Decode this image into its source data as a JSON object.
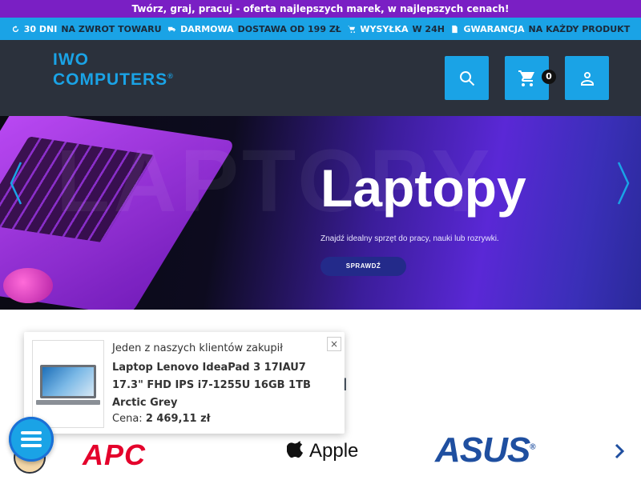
{
  "topbar": {
    "text": "Twórz, graj, pracuj - oferta najlepszych marek, w najlepszych cenach!"
  },
  "benefits": [
    {
      "icon": "return-icon",
      "highlight": "30 DNI",
      "text": "NA ZWROT TOWARU"
    },
    {
      "icon": "truck-icon",
      "highlight": "DARMOWA",
      "text": "DOSTAWA OD 199 ZŁ"
    },
    {
      "icon": "cart-icon",
      "highlight": "WYSYŁKA",
      "text": "W 24H"
    },
    {
      "icon": "document-icon",
      "highlight": "GWARANCJA",
      "text": "NA KAŻDY PRODUKT"
    }
  ],
  "logo": {
    "line1": "IWO",
    "line2": "COMPUTERS",
    "mark": "®"
  },
  "header": {
    "cart_count": "0"
  },
  "banner": {
    "title": "Laptopy",
    "subtitle": "Znajdź idealny sprzęt do pracy, nauki lub rozrywki.",
    "cta": "SPRAWDŹ",
    "background_word": "LAPTOPY"
  },
  "section": {
    "partial_heading": "I"
  },
  "brands": {
    "apc": "APC",
    "apple": "Apple",
    "asus": "ASUS",
    "asus_mark": "®"
  },
  "popup": {
    "line1": "Jeden z naszych klientów zakupił",
    "product": "Laptop Lenovo IdeaPad 3 17IAU7 17.3\" FHD IPS i7-1255U 16GB 1TB Arctic Grey",
    "price_label": "Cena:",
    "price": "2 469,11 zł",
    "close": "×"
  },
  "colors": {
    "accent": "#1aa3e6",
    "topbar": "#7a1fc4",
    "header": "#2b313c"
  }
}
